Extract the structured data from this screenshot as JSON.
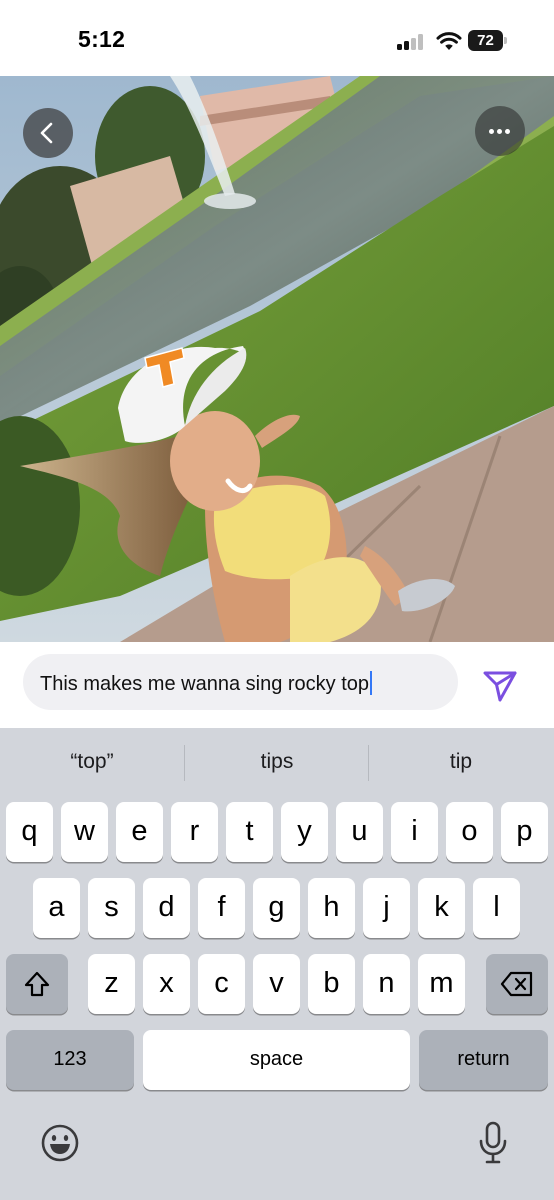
{
  "status_bar": {
    "time": "5:12",
    "battery": "72"
  },
  "photo": {
    "subject": "selfie-photo",
    "more_icon": "ellipsis-icon",
    "back_icon": "chevron-left-icon"
  },
  "compose": {
    "message_value": "This makes me wanna sing rocky top",
    "send_icon": "send-icon",
    "accent_color": "#7b4fe0"
  },
  "keyboard": {
    "suggestions": [
      "“top”",
      "tips",
      "tip"
    ],
    "row1": [
      "q",
      "w",
      "e",
      "r",
      "t",
      "y",
      "u",
      "i",
      "o",
      "p"
    ],
    "row2": [
      "a",
      "s",
      "d",
      "f",
      "g",
      "h",
      "j",
      "k",
      "l"
    ],
    "row3": [
      "z",
      "x",
      "c",
      "v",
      "b",
      "n",
      "m"
    ],
    "numbers_label": "123",
    "space_label": "space",
    "return_label": "return",
    "shift_icon": "shift-icon",
    "delete_icon": "backspace-icon",
    "emoji_icon": "emoji-icon",
    "mic_icon": "microphone-icon"
  }
}
